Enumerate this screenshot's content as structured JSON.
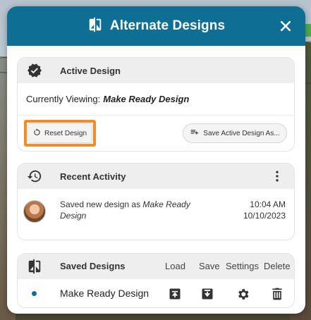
{
  "dialog": {
    "title": "Alternate Designs",
    "icon": "compare-icon",
    "close_icon": "close-icon"
  },
  "active_design": {
    "title": "Active Design",
    "icon": "verified-badge-icon",
    "viewing_label": "Currently Viewing:",
    "viewing_value": "Make Ready Design",
    "reset_button": "Reset Design",
    "save_as_button": "Save Active Design As..."
  },
  "recent_activity": {
    "title": "Recent Activity",
    "icon": "history-icon",
    "more_icon": "more-vertical-icon",
    "entry": {
      "text_prefix": "Saved new design as",
      "design_name": "Make Ready Design",
      "time": "10:04 AM",
      "date": "10/10/2023"
    }
  },
  "saved_designs": {
    "title": "Saved Designs",
    "icon": "compare-icon",
    "columns": {
      "load": "Load",
      "save": "Save",
      "settings": "Settings",
      "delete": "Delete"
    },
    "rows": [
      {
        "name": "Make Ready Design",
        "active": true
      }
    ]
  },
  "colors": {
    "header": "#0f6e93",
    "highlight": "#f28c28",
    "active_dot": "#0f6e93"
  }
}
